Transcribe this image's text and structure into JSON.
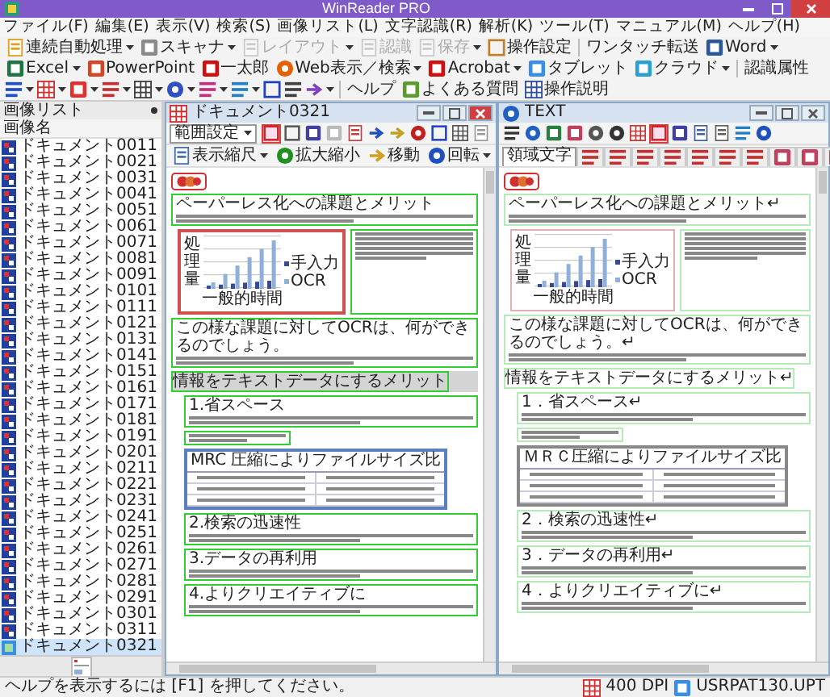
{
  "window": {
    "title": "WinReader PRO"
  },
  "menu": [
    "ファイル(F)",
    "編集(E)",
    "表示(V)",
    "検索(S)",
    "画像リスト(L)",
    "文字認識(R)",
    "解析(K)",
    "ツール(T)",
    "マニュアル(M)",
    "ヘルプ(H)"
  ],
  "toolbar": [
    {
      "kind": "batch",
      "label": "連続自動処理",
      "disabled": false,
      "dropdown": true
    },
    {
      "kind": "scanner",
      "label": "スキャナ",
      "disabled": false,
      "dropdown": true
    },
    {
      "kind": "layout",
      "label": "レイアウト",
      "disabled": true,
      "dropdown": true
    },
    {
      "kind": "recognize",
      "label": "認識",
      "disabled": true,
      "dropdown": false
    },
    {
      "kind": "save",
      "label": "保存",
      "disabled": true,
      "dropdown": true
    },
    {
      "kind": "settings",
      "label": "操作設定",
      "disabled": false,
      "dropdown": false
    }
  ],
  "transfer": {
    "label": "ワンタッチ転送",
    "apps": [
      {
        "kind": "word",
        "label": "Word",
        "dropdown": true
      },
      {
        "kind": "excel",
        "label": "Excel",
        "dropdown": true
      },
      {
        "kind": "powerpoint",
        "label": "PowerPoint",
        "dropdown": false
      },
      {
        "kind": "ichitaro",
        "label": "一太郎",
        "dropdown": false
      },
      {
        "kind": "web",
        "label": "Web表示／検索",
        "dropdown": true
      },
      {
        "kind": "acrobat",
        "label": "Acrobat",
        "dropdown": true
      },
      {
        "kind": "tablet",
        "label": "タブレット",
        "dropdown": false
      },
      {
        "kind": "cloud",
        "label": "クラウド",
        "dropdown": true
      }
    ]
  },
  "attributes": {
    "label": "認識属性",
    "tools": [
      {
        "kind": "text",
        "dropdown": true
      },
      {
        "kind": "color",
        "dropdown": true
      },
      {
        "kind": "photo",
        "dropdown": true
      },
      {
        "kind": "figure",
        "dropdown": true
      },
      {
        "kind": "table",
        "dropdown": true
      },
      {
        "kind": "user",
        "dropdown": true
      },
      {
        "kind": "column",
        "dropdown": true
      },
      {
        "kind": "rule",
        "dropdown": true
      },
      {
        "kind": "font",
        "dropdown": false
      },
      {
        "kind": "vertical",
        "dropdown": false
      },
      {
        "kind": "branch",
        "dropdown": true
      }
    ]
  },
  "help": {
    "label": "ヘルプ",
    "buttons": [
      {
        "kind": "faq",
        "label": "よくある質問"
      },
      {
        "kind": "manual",
        "label": "操作説明"
      }
    ]
  },
  "image_list": {
    "title": "画像リスト",
    "column": "画像名",
    "items": [
      {
        "name": "ドキュメント0011",
        "selected": false
      },
      {
        "name": "ドキュメント0021",
        "selected": false
      },
      {
        "name": "ドキュメント0031",
        "selected": false
      },
      {
        "name": "ドキュメント0041",
        "selected": false
      },
      {
        "name": "ドキュメント0051",
        "selected": false
      },
      {
        "name": "ドキュメント0061",
        "selected": false
      },
      {
        "name": "ドキュメント0071",
        "selected": false
      },
      {
        "name": "ドキュメント0081",
        "selected": false
      },
      {
        "name": "ドキュメント0091",
        "selected": false
      },
      {
        "name": "ドキュメント0101",
        "selected": false
      },
      {
        "name": "ドキュメント0111",
        "selected": false
      },
      {
        "name": "ドキュメント0121",
        "selected": false
      },
      {
        "name": "ドキュメント0131",
        "selected": false
      },
      {
        "name": "ドキュメント0141",
        "selected": false
      },
      {
        "name": "ドキュメント0151",
        "selected": false
      },
      {
        "name": "ドキュメント0161",
        "selected": false
      },
      {
        "name": "ドキュメント0171",
        "selected": false
      },
      {
        "name": "ドキュメント0181",
        "selected": false
      },
      {
        "name": "ドキュメント0191",
        "selected": false
      },
      {
        "name": "ドキュメント0201",
        "selected": false
      },
      {
        "name": "ドキュメント0211",
        "selected": false
      },
      {
        "name": "ドキュメント0221",
        "selected": false
      },
      {
        "name": "ドキュメント0231",
        "selected": false
      },
      {
        "name": "ドキュメント0241",
        "selected": false
      },
      {
        "name": "ドキュメント0251",
        "selected": false
      },
      {
        "name": "ドキュメント0261",
        "selected": false
      },
      {
        "name": "ドキュメント0271",
        "selected": false
      },
      {
        "name": "ドキュメント0281",
        "selected": false
      },
      {
        "name": "ドキュメント0291",
        "selected": false
      },
      {
        "name": "ドキュメント0301",
        "selected": false
      },
      {
        "name": "ドキュメント0311",
        "selected": false
      },
      {
        "name": "ドキュメント0321",
        "selected": true
      }
    ]
  },
  "document_window": {
    "title": "ドキュメント0321",
    "range": "範囲設定",
    "tools": [
      {
        "kind": "area",
        "pressed": true
      },
      {
        "kind": "frame",
        "pressed": false
      },
      {
        "kind": "block",
        "pressed": false
      },
      {
        "kind": "blank",
        "pressed": false
      },
      {
        "kind": "scan",
        "pressed": false
      },
      {
        "kind": "link",
        "pressed": false
      },
      {
        "kind": "cursor",
        "pressed": false
      },
      {
        "kind": "magic",
        "pressed": false
      },
      {
        "kind": "font",
        "pressed": false
      },
      {
        "kind": "grid",
        "pressed": false
      },
      {
        "kind": "recognize",
        "pressed": false
      }
    ],
    "view_tools": [
      {
        "kind": "scale",
        "label": "表示縮尺",
        "dropdown": true
      },
      {
        "kind": "zoom",
        "label": "拡大縮小",
        "dropdown": false
      },
      {
        "kind": "move",
        "label": "移動",
        "dropdown": false
      },
      {
        "kind": "rotate",
        "label": "回転",
        "dropdown": true
      }
    ],
    "page": [
      {
        "kind": "logo"
      },
      {
        "kind": "paragraph",
        "heading": "ペーパーレス化への課題とメリット"
      },
      {
        "kind": "figure",
        "legend": [
          "手入力",
          "OCR"
        ],
        "ylabel": "処理量",
        "xlabel": "一般的時間"
      },
      {
        "kind": "paragraph",
        "heading": "この様な課題に対してOCRは、何ができるのでしょう。"
      },
      {
        "kind": "section",
        "heading": "情報をテキストデータにするメリット"
      },
      {
        "kind": "item",
        "heading": "1.省スペース"
      },
      {
        "kind": "table",
        "caption": "MRC 圧縮によりファイルサイズ比"
      },
      {
        "kind": "item",
        "heading": "2.検索の迅速性"
      },
      {
        "kind": "item",
        "heading": "3.データの再利用"
      },
      {
        "kind": "item",
        "heading": "4.よりクリエイティブに"
      }
    ]
  },
  "text_window": {
    "title": "TEXT",
    "tools": [
      {
        "kind": "cut",
        "pressed": false
      },
      {
        "kind": "find",
        "pressed": false
      },
      {
        "kind": "book",
        "pressed": false
      },
      {
        "kind": "mark",
        "pressed": false
      },
      {
        "kind": "search",
        "pressed": false
      },
      {
        "kind": "searchnext",
        "pressed": false
      },
      {
        "kind": "color",
        "pressed": false
      },
      {
        "kind": "area",
        "pressed": true
      },
      {
        "kind": "block",
        "pressed": false
      },
      {
        "kind": "copy",
        "pressed": false
      },
      {
        "kind": "paste",
        "pressed": false
      },
      {
        "kind": "rule",
        "pressed": false
      },
      {
        "kind": "rotate",
        "pressed": false
      }
    ],
    "tabs": [
      {
        "kind": "text",
        "label": "領域文字",
        "selected": true
      },
      {
        "kind": "figure",
        "selected": false
      },
      {
        "kind": "figure",
        "selected": false
      },
      {
        "kind": "figure",
        "selected": false
      },
      {
        "kind": "figure",
        "selected": false
      },
      {
        "kind": "figure",
        "selected": false
      },
      {
        "kind": "figure",
        "selected": false
      },
      {
        "kind": "figure",
        "selected": false
      },
      {
        "kind": "mark",
        "selected": false
      },
      {
        "kind": "mark",
        "selected": false
      },
      {
        "kind": "mark",
        "selected": false
      }
    ],
    "page": [
      {
        "kind": "logo"
      },
      {
        "kind": "paragraph",
        "heading": "ペーパーレス化への課題とメリット↵"
      },
      {
        "kind": "figure",
        "legend": [
          "手入力",
          "OCR"
        ],
        "ylabel": "処理量",
        "xlabel": "一般的時間"
      },
      {
        "kind": "paragraph",
        "heading": "この様な課題に対してOCRは、何ができるのでしょう。↵"
      },
      {
        "kind": "section",
        "heading": "情報をテキストデータにするメリット↵"
      },
      {
        "kind": "item",
        "heading": "1．省スペース↵"
      },
      {
        "kind": "table",
        "caption": "ＭＲＣ圧縮によりファイルサイズ比"
      },
      {
        "kind": "item",
        "heading": "2．検索の迅速性↵"
      },
      {
        "kind": "item",
        "heading": "3．データの再利用↵"
      },
      {
        "kind": "item",
        "heading": "4．よりクリエイティブに↵"
      }
    ]
  },
  "status_bar": {
    "message": "ヘルプを表示するには [F1] を押してください。",
    "resolution": "400 DPI",
    "pattern": "USRPAT130.UPT"
  }
}
